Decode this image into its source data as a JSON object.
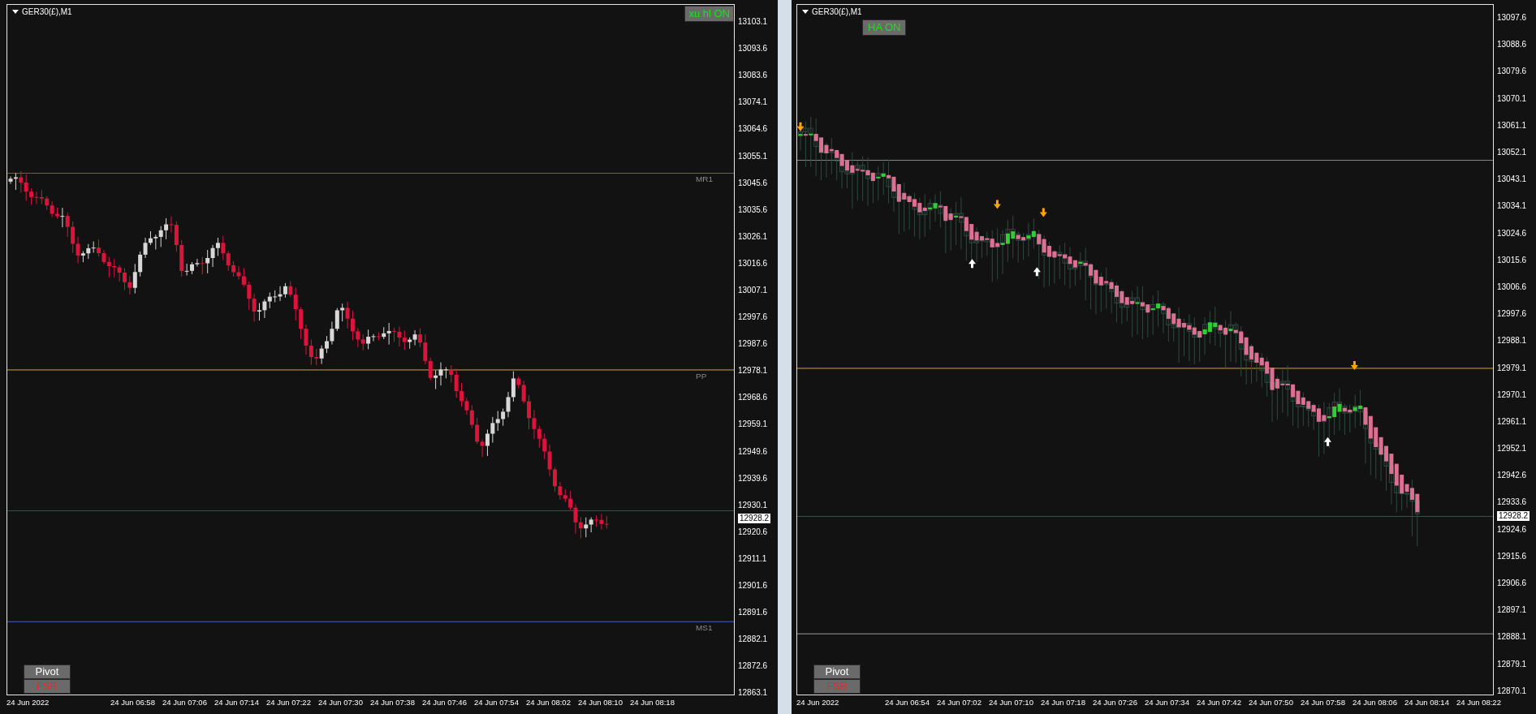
{
  "charts": [
    {
      "title": "GER30(£),M1",
      "toggle": {
        "label": "xu hl ON",
        "on": true
      },
      "levels": [
        {
          "label": "MR1"
        },
        {
          "label": "PP"
        },
        {
          "label": "MS1"
        }
      ],
      "buttons": [
        {
          "label": "Pivot",
          "on": true
        },
        {
          "label": "FSR",
          "on": false
        }
      ],
      "price_ticks": [
        {
          "label": "13103.1",
          "kind": "tick"
        },
        {
          "label": "13093.6",
          "kind": "tick"
        },
        {
          "label": "13083.6",
          "kind": "tick"
        },
        {
          "label": "13074.1",
          "kind": "tick"
        },
        {
          "label": "13064.6",
          "kind": "tick"
        },
        {
          "label": "13055.1",
          "kind": "tick"
        },
        {
          "label": "13045.6",
          "kind": "tick"
        },
        {
          "label": "13035.6",
          "kind": "tick"
        },
        {
          "label": "13026.1",
          "kind": "tick"
        },
        {
          "label": "13016.6",
          "kind": "tick"
        },
        {
          "label": "13007.1",
          "kind": "tick"
        },
        {
          "label": "12997.6",
          "kind": "tick"
        },
        {
          "label": "12987.6",
          "kind": "tick"
        },
        {
          "label": "12978.1",
          "kind": "tick"
        },
        {
          "label": "12968.6",
          "kind": "tick"
        },
        {
          "label": "12959.1",
          "kind": "tick"
        },
        {
          "label": "12949.6",
          "kind": "tick"
        },
        {
          "label": "12939.6",
          "kind": "tick"
        },
        {
          "label": "12930.1",
          "kind": "tick"
        },
        {
          "label": "12928.2",
          "kind": "current"
        },
        {
          "label": "12920.6",
          "kind": "tick"
        },
        {
          "label": "12911.1",
          "kind": "tick"
        },
        {
          "label": "12901.6",
          "kind": "tick"
        },
        {
          "label": "12891.6",
          "kind": "tick"
        },
        {
          "label": "12882.1",
          "kind": "tick"
        },
        {
          "label": "12872.6",
          "kind": "tick"
        },
        {
          "label": "12863.1",
          "kind": "tick"
        }
      ],
      "time_labels": [
        "24 Jun 2022",
        "24 Jun 06:58",
        "24 Jun 07:06",
        "24 Jun 07:14",
        "24 Jun 07:22",
        "24 Jun 07:30",
        "24 Jun 07:38",
        "24 Jun 07:46",
        "24 Jun 07:54",
        "24 Jun 08:02",
        "24 Jun 08:10",
        "24 Jun 08:18"
      ]
    },
    {
      "title": "GER30(£),M1",
      "toggle": {
        "label": "HA ON",
        "on": true
      },
      "buttons": [
        {
          "label": "Pivot",
          "on": true
        },
        {
          "label": "FSR",
          "on": false
        }
      ],
      "price_ticks": [
        {
          "label": "13097.6",
          "kind": "tick"
        },
        {
          "label": "13088.6",
          "kind": "tick"
        },
        {
          "label": "13079.6",
          "kind": "tick"
        },
        {
          "label": "13070.1",
          "kind": "tick"
        },
        {
          "label": "13061.1",
          "kind": "tick"
        },
        {
          "label": "13052.1",
          "kind": "tick"
        },
        {
          "label": "13043.1",
          "kind": "tick"
        },
        {
          "label": "13034.1",
          "kind": "tick"
        },
        {
          "label": "13024.6",
          "kind": "tick"
        },
        {
          "label": "13015.6",
          "kind": "tick"
        },
        {
          "label": "13006.6",
          "kind": "tick"
        },
        {
          "label": "12997.6",
          "kind": "tick"
        },
        {
          "label": "12988.1",
          "kind": "tick"
        },
        {
          "label": "12979.1",
          "kind": "tick"
        },
        {
          "label": "12970.1",
          "kind": "tick"
        },
        {
          "label": "12961.1",
          "kind": "tick"
        },
        {
          "label": "12952.1",
          "kind": "tick"
        },
        {
          "label": "12942.6",
          "kind": "tick"
        },
        {
          "label": "12933.6",
          "kind": "tick"
        },
        {
          "label": "12928.2",
          "kind": "current"
        },
        {
          "label": "12924.6",
          "kind": "tick"
        },
        {
          "label": "12915.6",
          "kind": "tick"
        },
        {
          "label": "12906.6",
          "kind": "tick"
        },
        {
          "label": "12897.1",
          "kind": "tick"
        },
        {
          "label": "12888.1",
          "kind": "tick"
        },
        {
          "label": "12879.1",
          "kind": "tick"
        },
        {
          "label": "12870.1",
          "kind": "tick"
        }
      ],
      "time_labels": [
        "24 Jun 2022",
        "24 Jun 06:54",
        "24 Jun 07:02",
        "24 Jun 07:10",
        "24 Jun 07:18",
        "24 Jun 07:26",
        "24 Jun 07:34",
        "24 Jun 07:42",
        "24 Jun 07:50",
        "24 Jun 07:58",
        "24 Jun 08:06",
        "24 Jun 08:14",
        "24 Jun 08:22"
      ]
    }
  ]
}
